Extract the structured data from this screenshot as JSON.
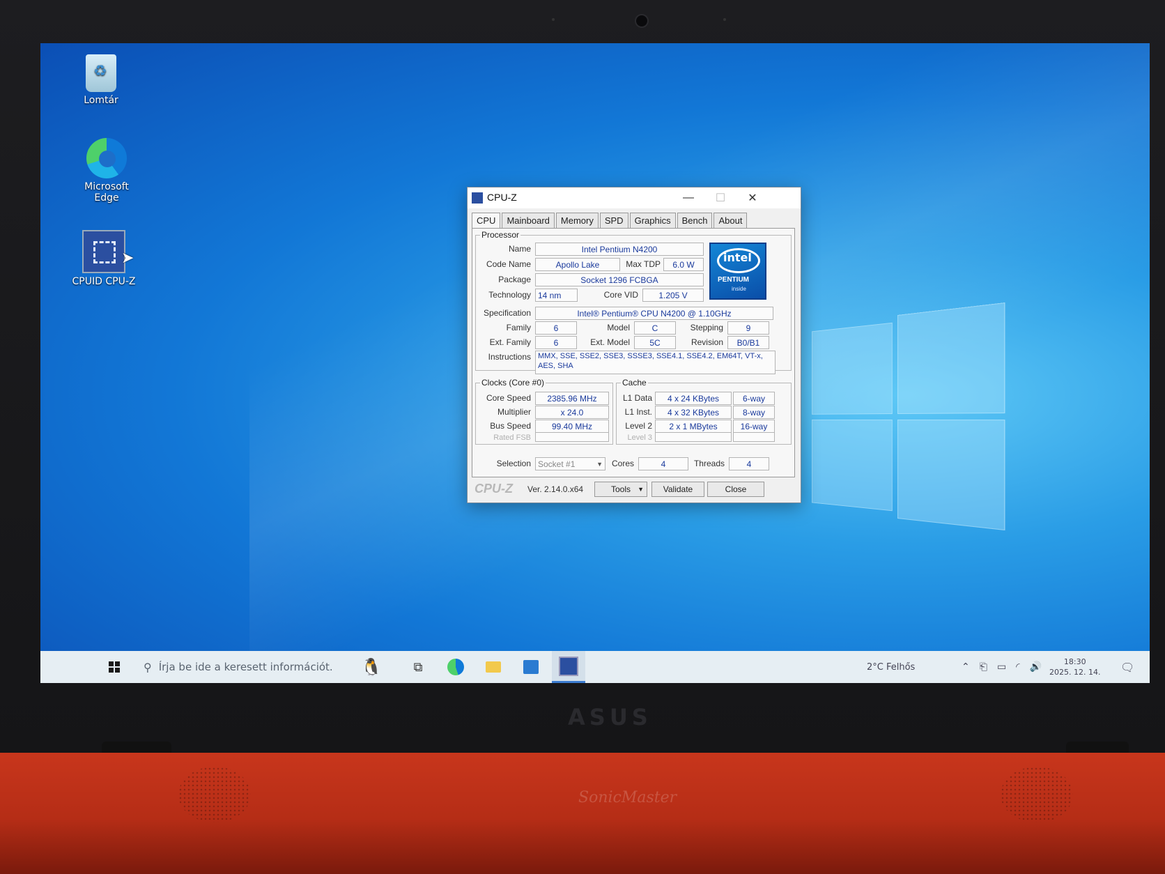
{
  "desktop": {
    "icons": [
      {
        "label_line1": "Lomtár",
        "label_line2": "",
        "icon": "recycle-bin-icon"
      },
      {
        "label_line1": "Microsoft",
        "label_line2": "Edge",
        "icon": "edge-icon"
      },
      {
        "label_line1": "CPUID CPU-Z",
        "label_line2": "",
        "icon": "cpuz-icon"
      }
    ]
  },
  "window": {
    "title": "CPU-Z",
    "tabs": [
      "CPU",
      "Mainboard",
      "Memory",
      "SPD",
      "Graphics",
      "Bench",
      "About"
    ],
    "active_tab": "CPU",
    "processor": {
      "legend": "Processor",
      "name_label": "Name",
      "name": "Intel Pentium N4200",
      "codename_label": "Code Name",
      "codename": "Apollo Lake",
      "maxtdp_label": "Max TDP",
      "maxtdp": "6.0 W",
      "package_label": "Package",
      "package": "Socket 1296 FCBGA",
      "technology_label": "Technology",
      "technology": "14 nm",
      "corevid_label": "Core VID",
      "corevid": "1.205 V",
      "spec_label": "Specification",
      "spec": "Intel® Pentium® CPU N4200 @ 1.10GHz",
      "family_label": "Family",
      "family": "6",
      "model_label": "Model",
      "model": "C",
      "stepping_label": "Stepping",
      "stepping": "9",
      "extfamily_label": "Ext. Family",
      "extfamily": "6",
      "extmodel_label": "Ext. Model",
      "extmodel": "5C",
      "revision_label": "Revision",
      "revision": "B0/B1",
      "instructions_label": "Instructions",
      "instructions_line1": "MMX, SSE, SSE2, SSE3, SSSE3, SSE4.1, SSE4.2, EM64T, VT-x,",
      "instructions_line2": "AES, SHA",
      "logo": {
        "brand": "intel",
        "product": "PENTIUM",
        "tag": "inside"
      }
    },
    "clocks": {
      "legend": "Clocks (Core #0)",
      "corespeed_label": "Core Speed",
      "corespeed": "2385.96 MHz",
      "multiplier_label": "Multiplier",
      "multiplier": "x 24.0",
      "busspeed_label": "Bus Speed",
      "busspeed": "99.40 MHz",
      "ratedfsb_label": "Rated FSB",
      "ratedfsb": ""
    },
    "cache": {
      "legend": "Cache",
      "l1data_label": "L1 Data",
      "l1data": "4 x 24 KBytes",
      "l1data_way": "6-way",
      "l1inst_label": "L1 Inst.",
      "l1inst": "4 x 32 KBytes",
      "l1inst_way": "8-way",
      "level2_label": "Level 2",
      "level2": "2 x 1 MBytes",
      "level2_way": "16-way",
      "level3_label": "Level 3",
      "level3": "",
      "level3_way": ""
    },
    "selection": {
      "selection_label": "Selection",
      "selection": "Socket #1",
      "cores_label": "Cores",
      "cores": "4",
      "threads_label": "Threads",
      "threads": "4"
    },
    "footer": {
      "logo_text": "CPU-Z",
      "version": "Ver. 2.14.0.x64",
      "tools": "Tools",
      "validate": "Validate",
      "close": "Close"
    }
  },
  "taskbar": {
    "search_placeholder": "Írja be ide a keresett információt.",
    "weather": "2°C Felhős",
    "time": "18:30",
    "date": "2025. 12. 14."
  },
  "hardware": {
    "brand": "ASUS",
    "speaker_brand": "SonicMaster"
  }
}
